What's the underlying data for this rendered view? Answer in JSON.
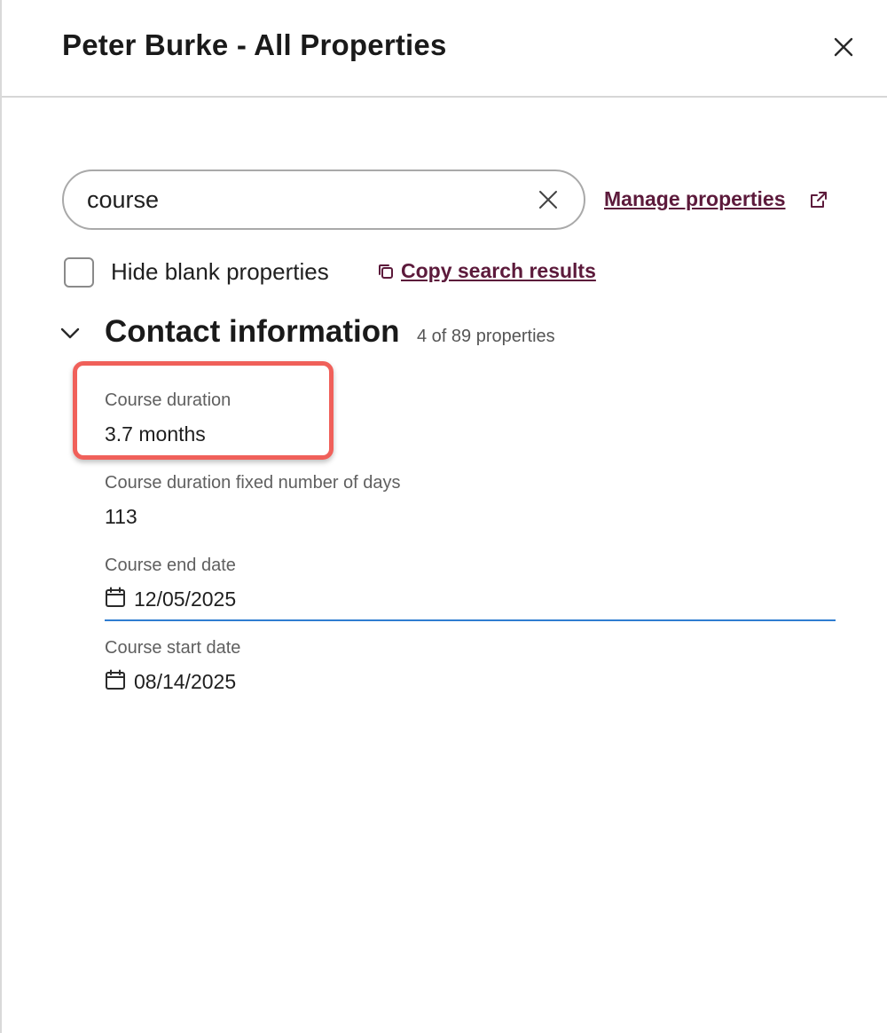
{
  "header": {
    "title": "Peter Burke - All Properties"
  },
  "search": {
    "value": "course"
  },
  "links": {
    "manage_properties": "Manage properties",
    "copy_search_results": "Copy search results"
  },
  "filters": {
    "hide_blank_label": "Hide blank properties",
    "hide_blank_checked": false
  },
  "section": {
    "title": "Contact information",
    "count": "4 of 89 properties",
    "properties": [
      {
        "label": "Course duration",
        "value": "3.7 months"
      },
      {
        "label": "Course duration fixed number of days",
        "value": "113"
      },
      {
        "label": "Course end date",
        "value": "12/05/2025",
        "icon": "calendar-icon"
      },
      {
        "label": "Course start date",
        "value": "08/14/2025",
        "icon": "calendar-icon"
      }
    ]
  },
  "colors": {
    "link": "#5c1a3b",
    "highlight": "#f0605a",
    "focus_underline": "#2f7dd1"
  }
}
